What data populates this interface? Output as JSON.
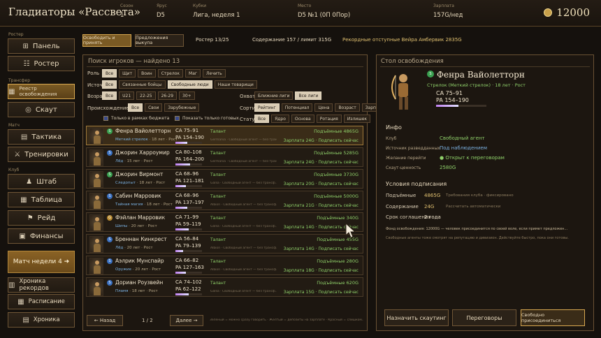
{
  "title": "Гладиаторы «Рассвета»",
  "header": {
    "season_label": "Сезон",
    "season": "1",
    "tier_label": "Ярус",
    "tier": "D5",
    "league_label": "Кубки",
    "league": "Лига, неделя 1",
    "place_label": "Место",
    "place": "D5 №1 (0П 0Пор)",
    "salary_label": "Зарплата",
    "salary": "157G/нед",
    "gold": "12000"
  },
  "sidebar": {
    "roster_caption": "Ростер",
    "transfer_caption": "Трансфер",
    "match_caption": "Матч",
    "club_caption": "Клуб",
    "items": [
      {
        "label": "Панель",
        "icon": "⊞"
      },
      {
        "label": "Ростер",
        "icon": "☷"
      },
      {
        "label": "Реестр освобождения",
        "icon": "▦"
      },
      {
        "label": "Скаут",
        "icon": "◎"
      },
      {
        "label": "Тактика",
        "icon": "▤"
      },
      {
        "label": "Тренировки",
        "icon": "⚔"
      },
      {
        "label": "Штаб",
        "icon": "♟"
      },
      {
        "label": "Таблица",
        "icon": "▦"
      },
      {
        "label": "Рейд",
        "icon": "⚑"
      },
      {
        "label": "Финансы",
        "icon": "▣"
      }
    ],
    "match_week": "Матч недели 4 ➜",
    "bottom": [
      {
        "label": "Хроника рекордов",
        "icon": "▥"
      },
      {
        "label": "Расписание",
        "icon": "▦"
      },
      {
        "label": "Хроника",
        "icon": "▤"
      }
    ]
  },
  "toolbar": {
    "tab1": "Освободить и принять",
    "tab2": "Предложения выкупа",
    "roster": "Ростер 13/25",
    "upkeep": "Содержание 157 / лимит 315G",
    "record": "Рекордные отступные Вейра Амбервик 2835G"
  },
  "search": {
    "title": "Поиск игроков — найдено 13",
    "role_label": "Роль",
    "roles": [
      "Все",
      "Щит",
      "Воин",
      "Стрелок",
      "Маг",
      "Лечить"
    ],
    "source_label": "Источник",
    "sources": [
      "Все",
      "Связанные бойцы",
      "Свободные люди",
      "Наши товарищи"
    ],
    "age_label": "Возраст",
    "ages": [
      "Все",
      "U21",
      "22-25",
      "26-29",
      "30+"
    ],
    "scope_label": "Охват",
    "scopes": [
      "Ближние лиги",
      "Все лиги"
    ],
    "origin_label": "Происхождение",
    "origins": [
      "Все",
      "Свои",
      "Зарубежные"
    ],
    "sort_label": "Сортировка",
    "sorts": [
      "Рейтинг",
      "Потенциал",
      "Цена",
      "Возраст",
      "Зарплата"
    ],
    "status_label": "Статус",
    "statuses": [
      "Все",
      "Ядро",
      "Основа",
      "Ротация",
      "Излишек"
    ],
    "check1": "Только в рамках бюджета",
    "check2": "Показать только готовых"
  },
  "players": [
    {
      "name": "Фенра Вайолетторн",
      "cls": "Меткий стрелок",
      "info": "· 18 лет · Рост",
      "ca": "CA  75–91",
      "pa": "PA  154–190",
      "pct": 0.45,
      "talent": "Талант",
      "desc": "Germania · Свободный агент — без трансф...",
      "buy": "Подъёмные 4865G",
      "sal": "Зарплата 24G · Подписать сейчас",
      "b": "S",
      "bc": "#3aa050",
      "sel": true
    },
    {
      "name": "Джорин Харроумир",
      "cls": "Лёд",
      "info": "· 15 лет · Рост",
      "ca": "CA  80–108",
      "pa": "PA  164–200",
      "pct": 0.55,
      "talent": "Талант",
      "desc": "Germania · Свободный агент — без трансф...",
      "buy": "Подъёмные 5285G",
      "sal": "Зарплата 24G · Подписать сейчас",
      "b": "S",
      "bc": "#3a70c0"
    },
    {
      "name": "Джорин Вирмонт",
      "cls": "Следопыт",
      "info": "· 18 лет · Рост",
      "ca": "CA  68–96",
      "pa": "PA  121–181",
      "pct": 0.4,
      "talent": "Талант",
      "desc": "Gallia · Свободный агент — без трансф...",
      "buy": "Подъёмные 3730G",
      "sal": "Зарплата 20G · Подписать сейчас",
      "b": "S",
      "bc": "#3aa050"
    },
    {
      "name": "Сабин Марровик",
      "cls": "Тайная магия",
      "info": "· 18 лет · Рост",
      "ca": "CA  68–96",
      "pa": "PA  137–197",
      "pct": 0.45,
      "talent": "Талант",
      "desc": "Albion · Свободный агент — без трансф...",
      "buy": "Подъёмные 5000G",
      "sal": "Зарплата 21G · Подписать сейчас",
      "b": "S",
      "bc": "#3a70c0"
    },
    {
      "name": "Фэйлан Марровик",
      "cls": "Шипы",
      "info": "· 20 лет · Рост",
      "ca": "CA  71–99",
      "pa": "PA  59–119",
      "pct": 0.5,
      "talent": "Талант",
      "desc": "Gallia · Свободный агент — без трансф...",
      "buy": "Подъёмные 340G",
      "sal": "Зарплата 14G · Подписать сейчас",
      "b": "G",
      "bc": "#b88a30"
    },
    {
      "name": "Бреннан Кинкрест",
      "cls": "Лёд",
      "info": "· 20 лет · Рост",
      "ca": "CA  56–84",
      "pa": "PA  79–139",
      "pct": 0.3,
      "talent": "Талант",
      "desc": "Albion · Свободный агент — без трансф...",
      "buy": "Подъёмные 455G",
      "sal": "Зарплата 14G · Подписать сейчас",
      "b": "S",
      "bc": "#3a70c0"
    },
    {
      "name": "Аэлрик Мунспайр",
      "cls": "Оружие",
      "info": "· 20 лет · Рост",
      "ca": "CA  66–82",
      "pa": "PA  127–163",
      "pct": 0.4,
      "talent": "Талант",
      "desc": "Albion · Свободный агент — без трансф...",
      "buy": "Подъёмные 280G",
      "sal": "Зарплата 18G · Подписать сейчас",
      "b": "S",
      "bc": "#3a70c0"
    },
    {
      "name": "Дориан Роузвейн",
      "cls": "Пламя",
      "info": "· 18 лет · Рост",
      "ca": "CA  74–102",
      "pa": "PA  62–122",
      "pct": 0.5,
      "talent": "Талант",
      "desc": "Gallia · Свободный агент — без трансф...",
      "buy": "Подъёмные 620G",
      "sal": "Зарплата 15G · Подписать сейчас",
      "b": "S",
      "bc": "#3a70c0"
    }
  ],
  "pager": {
    "prev": "← Назад",
    "page": "1 / 2",
    "next": "Далее →",
    "hint": "Зелёный = можно сразу говорить · Жёлтый = депозиты на зарплате · Красный = слишком..."
  },
  "detail": {
    "title": "Стол освобождения",
    "name": "Фенра Вайолетторн",
    "sub": "Стрелок (Меткий стрелок) · 18 лет · Рост",
    "ca": "CA  75–91",
    "pa": "PA  154–190",
    "info_title": "Инфо",
    "rows": [
      {
        "k": "Клуб",
        "v": "Свободный агент",
        "c": "#8fd06a"
      },
      {
        "k": "Источник разведданных",
        "v": "Под наблюдением",
        "c": "#7ab0e0"
      },
      {
        "k": "Желание перейти",
        "v": "● Открыт к переговорам",
        "c": "#8fd06a"
      },
      {
        "k": "Скаут-ценность",
        "v": "2580G",
        "c": "#8fd06a"
      }
    ],
    "terms_title": "Условия подписания",
    "t1k": "Подъёмные",
    "t1v": "4865G",
    "t1n": "Требования клуба · фиксировано",
    "t2k": "Содержание",
    "t2v": "24G",
    "t2n": "Рассчитать автоматически",
    "t3k": "Срок соглашения",
    "t3v": "2 года",
    "note1": "Фонд освобождения: 12000G — человек присоединится по своей воле, если примет предложен...",
    "note2": "Свободные агенты тоже смотрят на репутацию и дивизион. Действуйте быстро, пока они готовы.",
    "btn_scout": "Назначить скаутинг",
    "btn_talk": "Переговоры",
    "btn_join": "Свободно присоединиться"
  }
}
